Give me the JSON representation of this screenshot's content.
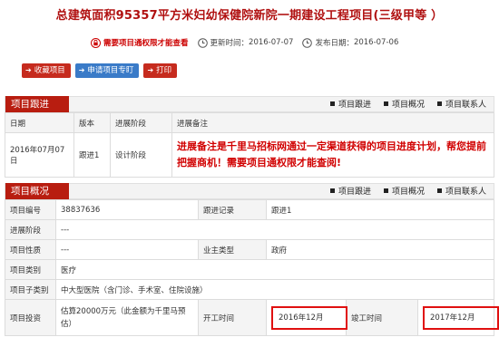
{
  "title": "总建筑面积95357平方米妇幼保健院新院一期建设工程项目(三级甲等 ）",
  "meta": {
    "need_permission": "需要项目通权限才能查看",
    "update_label": "更新时间：",
    "update_value": "2016-07-07",
    "publish_label": "发布日期：",
    "publish_value": "2016-07-06"
  },
  "toolbar": {
    "fav": "收藏项目",
    "apply": "申请项目专盯",
    "print": "打印"
  },
  "followup": {
    "tab": "项目跟进",
    "links": [
      "项目跟进",
      "项目概况",
      "项目联系人"
    ],
    "headers": [
      "日期",
      "版本",
      "进展阶段",
      "进展备注"
    ],
    "row": {
      "date": "2016年07月07日",
      "version": "跟进1",
      "stage": "设计阶段",
      "note": "进展备注是千里马招标网通过一定渠道获得的项目进度计划，帮您提前把握商机！需要项目通权限才能查阅!"
    }
  },
  "overview": {
    "tab": "项目概况",
    "links": [
      "项目跟进",
      "项目概况",
      "项目联系人"
    ],
    "rows": {
      "code_label": "项目编号",
      "code_value": "38837636",
      "record_label": "跟进记录",
      "record_value": "跟进1",
      "stage_label": "进展阶段",
      "stage_value": "---",
      "nature_label": "项目性质",
      "nature_value": "---",
      "owner_type_label": "业主类型",
      "owner_type_value": "政府",
      "category_label": "项目类别",
      "category_value": "医疗",
      "subcat_label": "项目子类别",
      "subcat_value": "中大型医院（含门诊、手术室、住院设施）",
      "invest_label": "项目投资",
      "invest_value": "估算20000万元（此金额为千里马预估）",
      "start_label": "开工时间",
      "start_value": "2016年12月",
      "end_label": "竣工时间",
      "end_value": "2017年12月"
    }
  },
  "colors": {
    "accent_red": "#b81d10",
    "button_blue": "#3a7bc8",
    "highlight": "#e01010"
  }
}
